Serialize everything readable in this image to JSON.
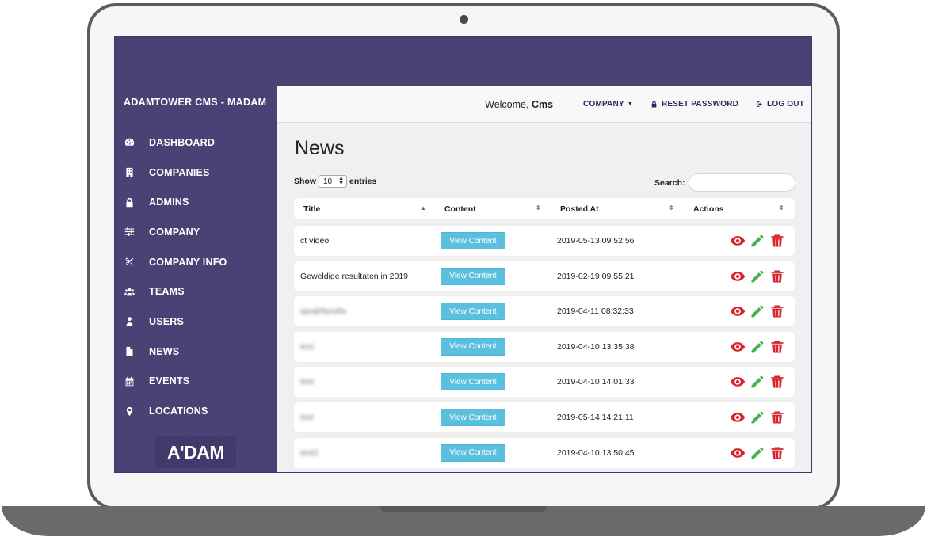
{
  "sidebar": {
    "brand": "ADAMTOWER CMS - MADAM",
    "items": [
      {
        "label": "DASHBOARD",
        "icon": "dashboard-icon"
      },
      {
        "label": "COMPANIES",
        "icon": "building-icon"
      },
      {
        "label": "ADMINS",
        "icon": "lock-icon"
      },
      {
        "label": "COMPANY",
        "icon": "sliders-icon"
      },
      {
        "label": "COMPANY INFO",
        "icon": "scissors-icon"
      },
      {
        "label": "TEAMS",
        "icon": "users-group-icon"
      },
      {
        "label": "USERS",
        "icon": "user-icon"
      },
      {
        "label": "NEWS",
        "icon": "file-icon"
      },
      {
        "label": "EVENTS",
        "icon": "calendar-icon"
      },
      {
        "label": "LOCATIONS",
        "icon": "map-pin-icon"
      }
    ],
    "logo_text": "A'DAM"
  },
  "header": {
    "welcome_prefix": "Welcome,",
    "welcome_user": "Cms",
    "company_label": "COMPANY",
    "reset_password_label": "RESET PASSWORD",
    "logout_label": "LOG OUT"
  },
  "page": {
    "title": "News",
    "show_label": "Show",
    "entries_value": "10",
    "entries_label": "entries",
    "search_label": "Search:",
    "search_value": ""
  },
  "table": {
    "columns": [
      "Title",
      "Content",
      "Posted At",
      "Actions"
    ],
    "button_label": "View Content",
    "rows": [
      {
        "title": "ct video",
        "posted_at": "2019-05-13 09:52:56",
        "blurred": false
      },
      {
        "title": "Geweldige resultaten in 2019",
        "posted_at": "2019-02-19 09:55:21",
        "blurred": false
      },
      {
        "title": "ajsajhfiysdfa",
        "posted_at": "2019-04-11 08:32:33",
        "blurred": true
      },
      {
        "title": "test",
        "posted_at": "2019-04-10 13:35:38",
        "blurred": true
      },
      {
        "title": "test",
        "posted_at": "2019-04-10 14:01:33",
        "blurred": true
      },
      {
        "title": "test",
        "posted_at": "2019-05-14 14:21:11",
        "blurred": true
      },
      {
        "title": "test2",
        "posted_at": "2019-04-10 13:50:45",
        "blurred": true
      }
    ]
  },
  "colors": {
    "sidebar_bg": "#4a4175",
    "button_bg": "#5bc0de",
    "view_icon": "#d9262d",
    "edit_icon": "#4cae4c",
    "delete_icon": "#d9262d"
  }
}
